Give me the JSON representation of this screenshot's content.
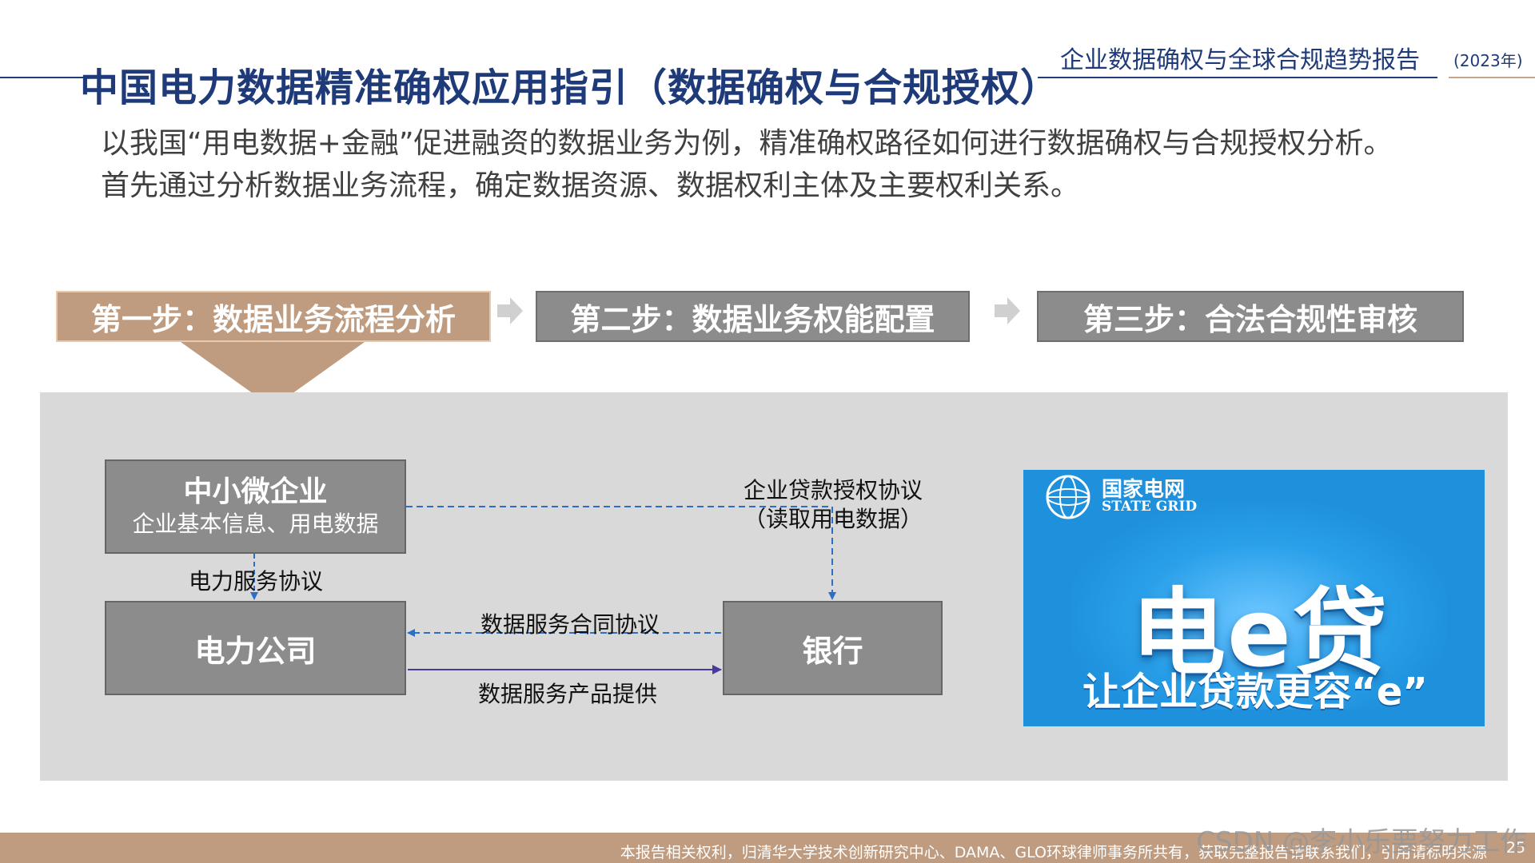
{
  "header": {
    "page_title": "中国电力数据精准确权应用指引（数据确权与合规授权）",
    "report_title": "企业数据确权与全球合规趋势报告",
    "report_year": "(2023年)"
  },
  "intro": {
    "line1": "以我国“用电数据+金融”促进融资的数据业务为例，精准确权路径如何进行数据确权与合规授权分析。",
    "line2": "首先通过分析数据业务流程，确定数据资源、数据权利主体及主要权利关系。"
  },
  "steps": [
    {
      "label": "第一步：数据业务流程分析",
      "active": true
    },
    {
      "label": "第二步：数据业务权能配置",
      "active": false
    },
    {
      "label": "第三步：合法合规性审核",
      "active": false
    }
  ],
  "diagram": {
    "nodes": {
      "sme": {
        "name": "中小微企业",
        "desc": "企业基本信息、用电数据"
      },
      "power_company": {
        "name": "电力公司"
      },
      "bank": {
        "name": "银行"
      }
    },
    "edges": {
      "loan_auth": {
        "line1": "企业贷款授权协议",
        "line2": "（读取用电数据）"
      },
      "power_service": {
        "label": "电力服务协议"
      },
      "data_contract": {
        "label": "数据服务合同协议"
      },
      "data_product": {
        "label": "数据服务产品提供"
      }
    },
    "colors": {
      "dashed": "#2e6dc4",
      "solid": "#4a3aa0"
    }
  },
  "ad": {
    "brand_cn": "国家电网",
    "brand_en": "STATE GRID",
    "headline": "电e贷",
    "tagline": "让企业贷款更容“e”"
  },
  "footer": {
    "text": "本报告相关权利，归清华大学技术创新研究中心、DAMA、GLO环球律师事务所共有，获取完整报告请联系我们，引用请标明来源",
    "page_number": "25",
    "watermark": "CSDN @李小乐要努力工作"
  },
  "colors": {
    "title_blue": "#1e3a78",
    "step_active": "#bf9c80",
    "step_inactive": "#8c8c8c",
    "panel": "#d9d9d9",
    "ad_blue": "#1e90dc"
  }
}
